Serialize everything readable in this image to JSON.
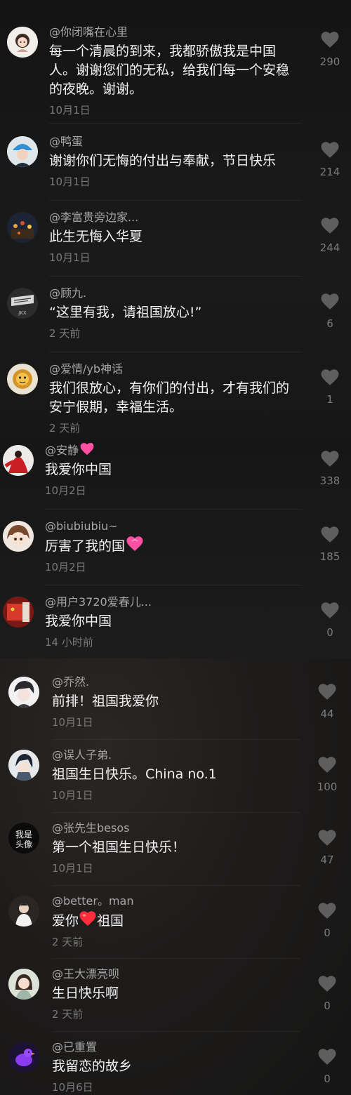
{
  "colors": {
    "background": "#161616",
    "username": "#a7a7a7",
    "comment_text": "#f2f2f2",
    "time": "#7a7a7a",
    "like_icon": "#5e5e5e",
    "pink_heart": "#ff4fa3",
    "red_heart": "#ff2d3b"
  },
  "comments": [
    {
      "username": "@你闭嘴在心里",
      "text": "每一个清晨的到来，我都骄傲我是中国人。谢谢您们的无私，给我们每一个安稳的夜晚。谢谢。",
      "time": "10月1日",
      "likes": "290",
      "avatar_icon": "cartoon-girl-avatar"
    },
    {
      "username": "@鸭蛋",
      "text": "谢谢你们无悔的付出与奉献，节日快乐",
      "time": "10月1日",
      "likes": "214",
      "avatar_icon": "blue-hat-avatar"
    },
    {
      "username": "@李富贵旁边家...",
      "text": "此生无悔入华夏",
      "time": "10月1日",
      "likes": "244",
      "avatar_icon": "night-lights-avatar"
    },
    {
      "username": "@顾九.",
      "text": "“这里有我，请祖国放心!”",
      "time": "2 天前",
      "likes": "6",
      "avatar_icon": "dark-sketch-avatar"
    },
    {
      "username": "@爱情/yb神话",
      "text": "我们很放心，有你们的付出，才有我们的安宁假期，幸福生活。",
      "time": "2 天前",
      "likes": "1",
      "avatar_icon": "golden-mask-avatar"
    },
    {
      "username": "@安静",
      "suffix_icon": "pink-heart-emoji",
      "text": "我爱你中国",
      "time": "10月2日",
      "likes": "338",
      "avatar_icon": "red-dress-avatar"
    },
    {
      "username": "@biubiubiu~",
      "text": "厉害了我的国",
      "text_suffix_icon": "pink-heart-emoji",
      "time": "10月2日",
      "likes": "185",
      "avatar_icon": "anime-girl-avatar"
    },
    {
      "username": "@用户3720爱春儿...",
      "text": "我爱你中国",
      "time": "14 小时前",
      "likes": "0",
      "avatar_icon": "flag-avatar"
    },
    {
      "username": "@乔然.",
      "text": "前排！祖国我爱你",
      "time": "10月1日",
      "likes": "44",
      "avatar_icon": "anime-boy-avatar"
    },
    {
      "username": "@误人子弟.",
      "text": "祖国生日快乐。China no.1",
      "time": "10月1日",
      "likes": "100",
      "avatar_icon": "anime-swordsman-avatar"
    },
    {
      "username": "@张先生besos",
      "text": "第一个祖国生日快乐！",
      "time": "10月1日",
      "likes": "47",
      "avatar_icon": "calligraphy-avatar",
      "avatar_text": "我是\n头像"
    },
    {
      "username": "@better。man",
      "text_before": "爱你",
      "text_after": "祖国",
      "inline_icon": "red-heart-emoji",
      "time": "2 天前",
      "likes": "0",
      "avatar_icon": "man-photo-avatar"
    },
    {
      "username": "@王大漂亮呗",
      "text": "生日快乐啊",
      "time": "2 天前",
      "likes": "0",
      "avatar_icon": "woman-photo-avatar"
    },
    {
      "username": "@已重置",
      "text": "我留恋的故乡",
      "time": "10月6日",
      "likes": "0",
      "avatar_icon": "purple-duck-avatar"
    }
  ]
}
